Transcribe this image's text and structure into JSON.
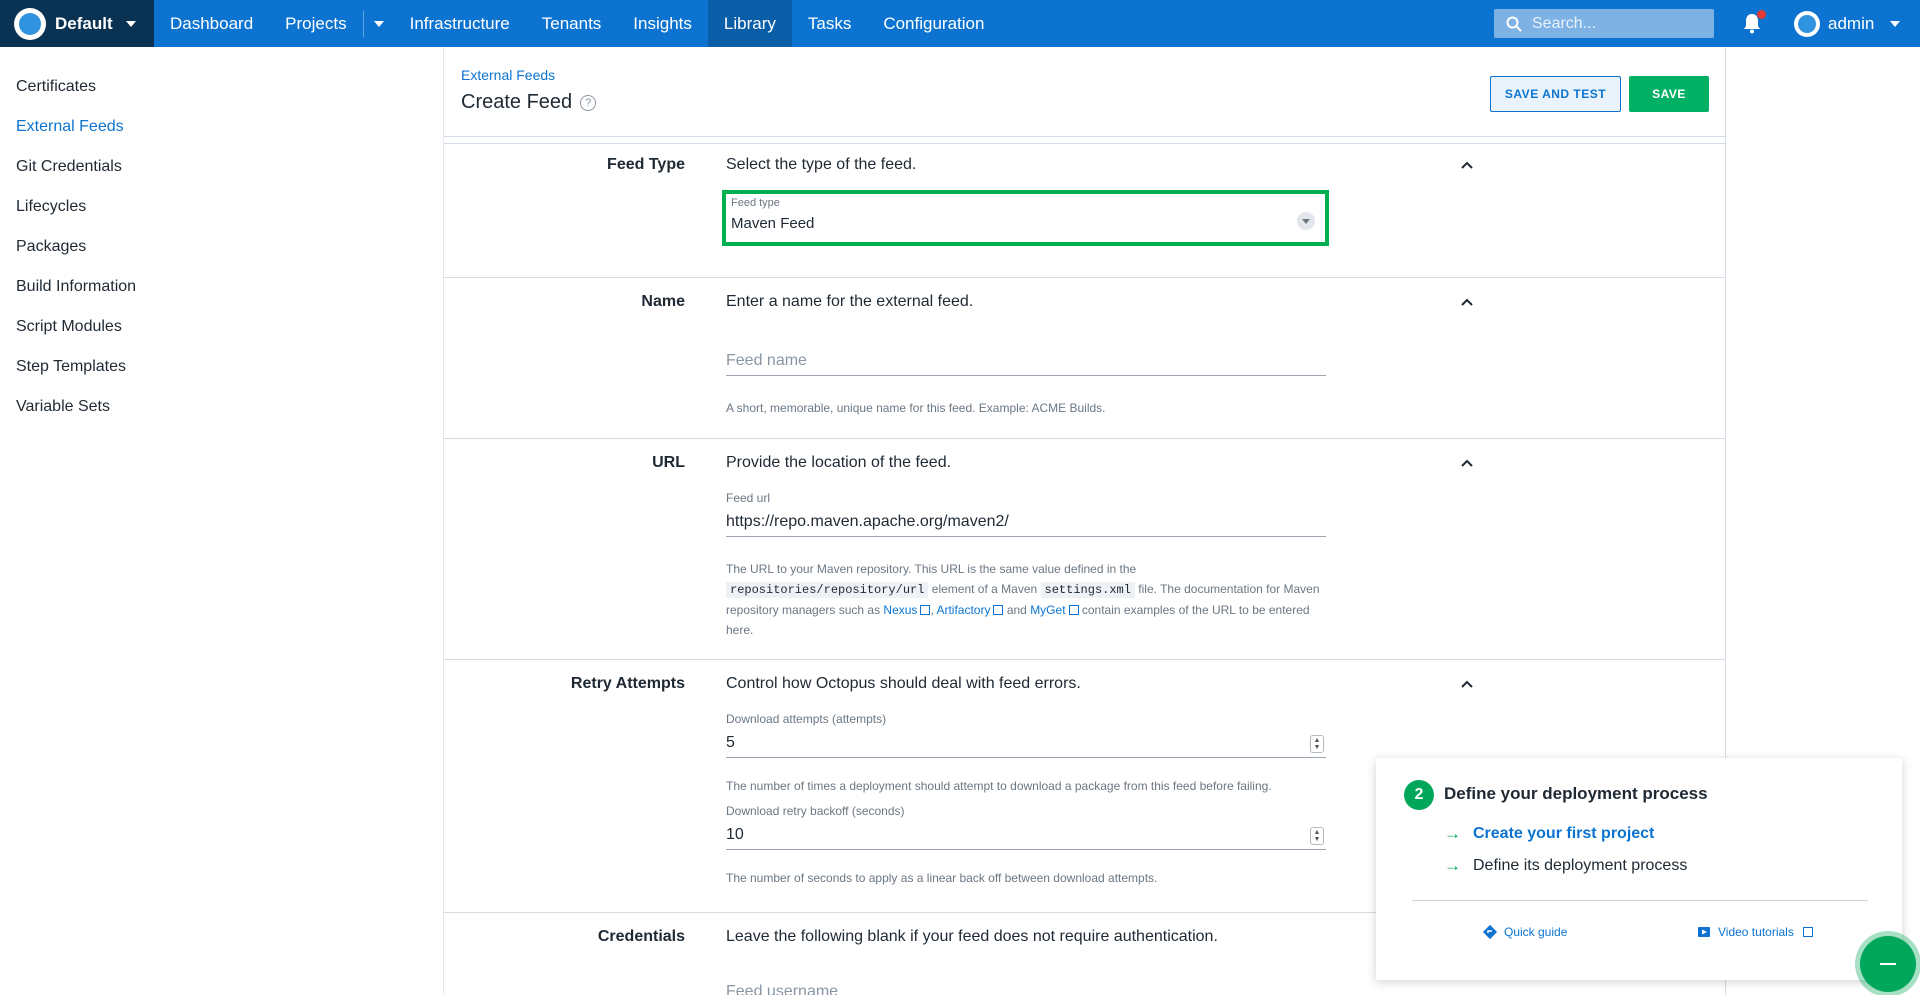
{
  "nav": {
    "space": "Default",
    "items": [
      "Dashboard",
      "Projects",
      "Infrastructure",
      "Tenants",
      "Insights",
      "Library",
      "Tasks",
      "Configuration"
    ],
    "active": "Library",
    "search_placeholder": "Search...",
    "user": "admin"
  },
  "sidebar": {
    "items": [
      {
        "label": "Certificates"
      },
      {
        "label": "External Feeds"
      },
      {
        "label": "Git Credentials"
      },
      {
        "label": "Lifecycles"
      },
      {
        "label": "Packages"
      },
      {
        "label": "Build Information"
      },
      {
        "label": "Script Modules"
      },
      {
        "label": "Step Templates"
      },
      {
        "label": "Variable Sets"
      }
    ],
    "active": "External Feeds"
  },
  "header": {
    "breadcrumb": "External Feeds",
    "title": "Create Feed",
    "save_and_test": "SAVE AND TEST",
    "save": "SAVE"
  },
  "sections": {
    "feed_type": {
      "label": "Feed Type",
      "description": "Select the type of the feed.",
      "field_label": "Feed type",
      "value": "Maven Feed"
    },
    "name": {
      "label": "Name",
      "description": "Enter a name for the external feed.",
      "placeholder": "Feed name",
      "hint": "A short, memorable, unique name for this feed. Example: ACME Builds."
    },
    "url": {
      "label": "URL",
      "description": "Provide the location of the feed.",
      "field_label": "Feed url",
      "value": "https://repo.maven.apache.org/maven2/",
      "hint_1": "The URL to your Maven repository. This URL is the same value defined in the",
      "hint_code_1": "repositories/repository/url",
      "hint_2": "element of a Maven",
      "hint_code_2": "settings.xml",
      "hint_3": "file. The documentation for Maven repository managers such as",
      "link_nexus": "Nexus",
      "hint_4": ",",
      "link_artifactory": "Artifactory",
      "hint_5": "and",
      "link_myget": "MyGet",
      "hint_6": "contain examples of the URL to be entered here."
    },
    "retry": {
      "label": "Retry Attempts",
      "description": "Control how Octopus should deal with feed errors.",
      "attempts_label": "Download attempts (attempts)",
      "attempts_value": "5",
      "attempts_hint": "The number of times a deployment should attempt to download a package from this feed before failing.",
      "backoff_label": "Download retry backoff (seconds)",
      "backoff_value": "10",
      "backoff_hint": "The number of seconds to apply as a linear back off between download attempts."
    },
    "credentials": {
      "label": "Credentials",
      "description": "Leave the following blank if your feed does not require authentication.",
      "username_placeholder": "Feed username"
    }
  },
  "getting_started": {
    "step": "2",
    "title": "Define your deployment process",
    "item_1": "Create your first project",
    "item_2": "Define its deployment process",
    "quick_guide": "Quick guide",
    "video_tutorials": "Video tutorials"
  },
  "colors": {
    "nav_bg": "#0c74d0",
    "space_bg": "#0a3353",
    "accent": "#0c74d0",
    "save": "#00b065",
    "highlight": "#00b050"
  }
}
